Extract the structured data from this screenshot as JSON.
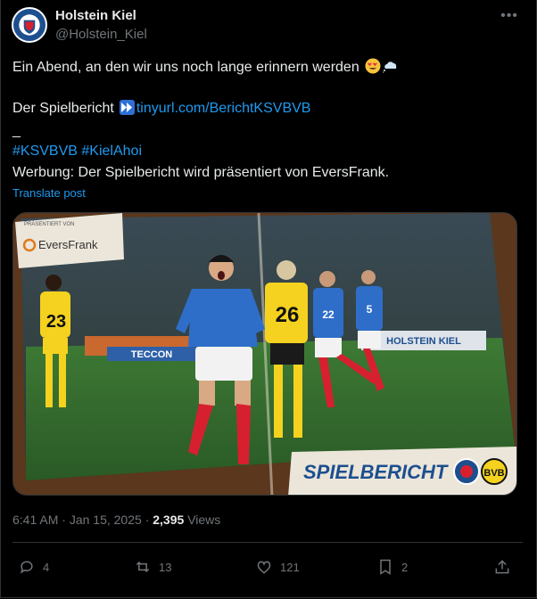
{
  "author": {
    "display_name": "Holstein Kiel",
    "handle": "@Holstein_Kiel"
  },
  "post": {
    "line1": "Ein Abend, an den wir uns noch lange erinnern werden",
    "report_label": "Der Spielbericht",
    "report_link": "tinyurl.com/BerichtKSVBVB",
    "separator": "_",
    "hashtag1": "#KSVBVB",
    "hashtag2": "#KielAhoi",
    "ad_line": "Werbung: Der Spielbericht wird präsentiert von EversFrank.",
    "translate_label": "Translate post"
  },
  "media": {
    "sponsor_caption": "PRÄSENTIERT VON",
    "sponsor_name": "EversFrank",
    "banner": "SPIELBERICHT",
    "stadium_board": "HOLSTEIN KIEL",
    "ad_board": "TECCON",
    "jersey_numbers": [
      "23",
      "26",
      "22",
      "5"
    ]
  },
  "meta": {
    "time": "6:41 AM",
    "date": "Jan 15, 2025",
    "separator": "·",
    "views_count": "2,395",
    "views_label": "Views"
  },
  "actions": {
    "replies": "4",
    "reposts": "13",
    "likes": "121",
    "bookmarks": "2"
  },
  "icons": [
    "more-icon",
    "heart-eyes-emoji",
    "cloud-emoji",
    "forward-icon",
    "reply-icon",
    "repost-icon",
    "like-icon",
    "bookmark-icon",
    "share-icon"
  ],
  "colors": {
    "background": "#000000",
    "text": "#e7e9ea",
    "muted": "#71767b",
    "link": "#1d9bf0",
    "divider": "#2f3336"
  }
}
